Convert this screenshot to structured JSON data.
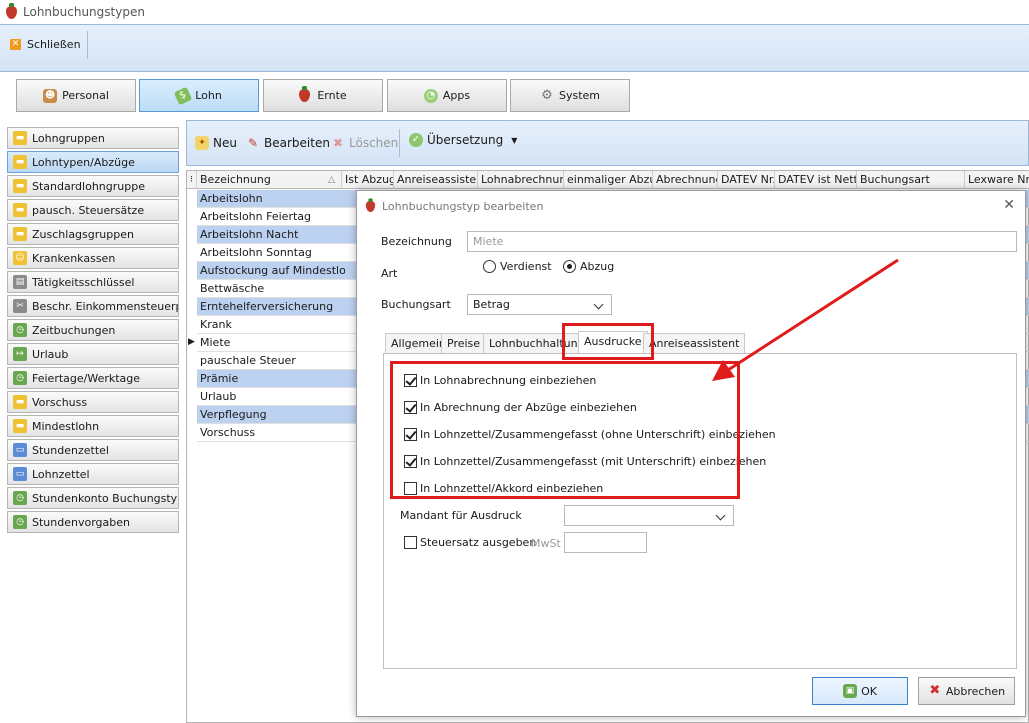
{
  "window": {
    "title": "Lohnbuchungstypen"
  },
  "ribbon": {
    "close_label": "Schließen"
  },
  "modules": [
    {
      "label": "Personal",
      "icon": "users-icon"
    },
    {
      "label": "Lohn",
      "icon": "money-icon",
      "active": true
    },
    {
      "label": "Ernte",
      "icon": "strawberry-icon"
    },
    {
      "label": "Apps",
      "icon": "apps-icon"
    },
    {
      "label": "System",
      "icon": "gear-icon"
    }
  ],
  "sidebar": {
    "items": [
      {
        "label": "Lohngruppen",
        "icon": "folder-icon"
      },
      {
        "label": "Lohntypen/Abzüge",
        "icon": "folder-icon",
        "active": true
      },
      {
        "label": "Standardlohngruppe",
        "icon": "folder-icon"
      },
      {
        "label": "pausch. Steuersätze",
        "icon": "folder-icon"
      },
      {
        "label": "Zuschlagsgruppen",
        "icon": "folder-icon"
      },
      {
        "label": "Krankenkassen",
        "icon": "smiley-icon"
      },
      {
        "label": "Tätigkeitsschlüssel",
        "icon": "keyboard-icon"
      },
      {
        "label": "Beschr. Einkommensteuerpfl.",
        "icon": "scissors-icon"
      },
      {
        "label": "Zeitbuchungen",
        "icon": "clock-icon"
      },
      {
        "label": "Urlaub",
        "icon": "exit-icon"
      },
      {
        "label": "Feiertage/Werktage",
        "icon": "clock-icon"
      },
      {
        "label": "Vorschuss",
        "icon": "folder-icon"
      },
      {
        "label": "Mindestlohn",
        "icon": "folder-icon"
      },
      {
        "label": "Stundenzettel",
        "icon": "printer-icon"
      },
      {
        "label": "Lohnzettel",
        "icon": "printer-icon"
      },
      {
        "label": "Stundenkonto Buchungstypen",
        "icon": "clock-icon"
      },
      {
        "label": "Stundenvorgaben",
        "icon": "clock-icon"
      }
    ]
  },
  "toolbar": {
    "new_label": "Neu",
    "edit_label": "Bearbeiten",
    "delete_label": "Löschen",
    "translate_label": "Übersetzung"
  },
  "grid": {
    "columns": [
      "Bezeichnung",
      "Ist Abzug",
      "Anreiseassistent",
      "Lohnabrechnung",
      "einmaliger Abzug",
      "Abrechnung",
      "DATEV Nr.",
      "DATEV ist Netto",
      "Buchungsart",
      "Lexware Nr."
    ],
    "sort_indicator": "△",
    "rows": [
      {
        "name": "Arbeitslohn",
        "shaded": true
      },
      {
        "name": "Arbeitslohn Feiertag",
        "shaded": false
      },
      {
        "name": "Arbeitslohn Nacht",
        "shaded": true
      },
      {
        "name": "Arbeitslohn Sonntag",
        "shaded": false
      },
      {
        "name": "Aufstockung auf Mindestlohn",
        "shaded": true
      },
      {
        "name": "Bettwäsche",
        "shaded": false
      },
      {
        "name": "Erntehelferversicherung",
        "shaded": true
      },
      {
        "name": "Krank",
        "shaded": false
      },
      {
        "name": "Miete",
        "shaded": false,
        "current": true
      },
      {
        "name": "pauschale Steuer",
        "shaded": false
      },
      {
        "name": "Prämie",
        "shaded": true
      },
      {
        "name": "Urlaub",
        "shaded": false
      },
      {
        "name": "Verpflegung",
        "shaded": true
      },
      {
        "name": "Vorschuss",
        "shaded": false
      }
    ],
    "current_marker": "▶"
  },
  "dialog": {
    "title": "Lohnbuchungstyp bearbeiten",
    "close_glyph": "✕",
    "bezeichnung_label": "Bezeichnung",
    "bezeichnung_value": "Miete",
    "art_label": "Art",
    "art_options": [
      "Verdienst",
      "Abzug"
    ],
    "art_selected": "Abzug",
    "buchungsart_label": "Buchungsart",
    "buchungsart_value": "Betrag",
    "tabs": [
      "Allgemein",
      "Preise",
      "Lohnbuchhaltung",
      "Ausdrucke",
      "Anreiseassistent"
    ],
    "active_tab": "Ausdrucke",
    "checkboxes": [
      {
        "label": "In Lohnabrechnung einbeziehen",
        "checked": true
      },
      {
        "label": "In Abrechnung der Abzüge einbeziehen",
        "checked": true
      },
      {
        "label": "In Lohnzettel/Zusammengefasst (ohne Unterschrift) einbeziehen",
        "checked": true
      },
      {
        "label": "In Lohnzettel/Zusammengefasst (mit Unterschrift) einbeziehen",
        "checked": true
      },
      {
        "label": "In Lohnzettel/Akkord einbeziehen",
        "checked": false
      }
    ],
    "mandant_label": "Mandant für Ausdruck",
    "mandant_value": "",
    "steuersatz_label": "Steuersatz ausgeben",
    "steuersatz_checked": false,
    "mwst_label": "MwSt",
    "mwst_value": "",
    "ok_label": "OK",
    "cancel_label": "Abbrechen"
  },
  "colors": {
    "annotation_red": "#e01b1b",
    "row_shade": "#bcd1f0",
    "ribbon": "#d3e3f5"
  }
}
